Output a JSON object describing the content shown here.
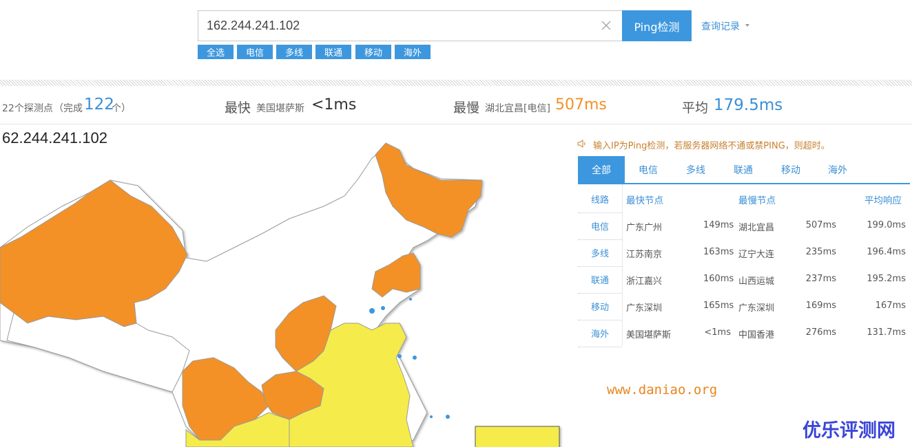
{
  "search": {
    "value": "162.244.241.102",
    "ping_button": "Ping检测",
    "history_link": "查询记录"
  },
  "filters": [
    "全选",
    "电信",
    "多线",
    "联通",
    "移动",
    "海外"
  ],
  "summary": {
    "probe_count": "22个探测点",
    "done_prefix": "（完成",
    "done_value": "122",
    "done_suffix": "个）",
    "fastest_label": "最快",
    "fastest_location": "美国堪萨斯",
    "fastest_value": "<1ms",
    "slowest_label": "最慢",
    "slowest_location": "湖北宜昌[电信]",
    "slowest_value": "507ms",
    "average_label": "平均",
    "average_value": "179.5ms"
  },
  "map_title": "62.244.241.102",
  "notice": "输入IP为Ping检测，若服务器网络不通或禁PING，则超时。",
  "tabs": [
    "全部",
    "电信",
    "多线",
    "联通",
    "移动",
    "海外"
  ],
  "table": {
    "headers": [
      "线路",
      "最快节点",
      "最慢节点",
      "平均响应"
    ],
    "rows": [
      [
        "电信",
        "广东广州",
        "149ms",
        "湖北宜昌",
        "507ms",
        "199.0ms"
      ],
      [
        "多线",
        "江苏南京",
        "163ms",
        "辽宁大连",
        "235ms",
        "196.4ms"
      ],
      [
        "联通",
        "浙江嘉兴",
        "160ms",
        "山西运城",
        "237ms",
        "195.2ms"
      ],
      [
        "移动",
        "广东深圳",
        "165ms",
        "广东深圳",
        "169ms",
        "167ms"
      ],
      [
        "海外",
        "美国堪萨斯",
        "<1ms",
        "中国香港",
        "276ms",
        "131.7ms"
      ]
    ]
  },
  "watermark": {
    "url": "www.daniao.org",
    "logo": "优乐评测网"
  },
  "colors": {
    "accent": "#3d97de",
    "orange": "#f39125",
    "yellow": "#f5ec4c"
  }
}
